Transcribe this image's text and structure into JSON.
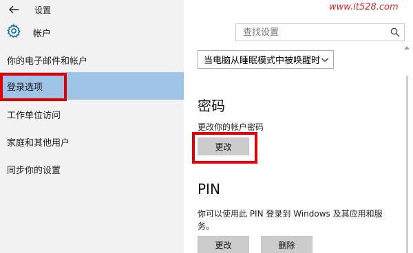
{
  "window": {
    "title": "设置"
  },
  "header": {
    "title": "帐户"
  },
  "search": {
    "placeholder": "查找设置"
  },
  "sidebar": {
    "items": [
      {
        "label": "你的电子邮件和帐户",
        "selected": false
      },
      {
        "label": "登录选项",
        "selected": true
      },
      {
        "label": "工作单位访问",
        "selected": false
      },
      {
        "label": "家庭和其他用户",
        "selected": false
      },
      {
        "label": "同步你的设置",
        "selected": false
      }
    ]
  },
  "main": {
    "wake_dropdown": {
      "value": "当电脑从睡眠模式中被唤醒时"
    },
    "password": {
      "title": "密码",
      "description": "更改你的帐户密码",
      "change_label": "更改"
    },
    "pin": {
      "title": "PIN",
      "description": "你可以使用此 PIN 登录到 Windows 及其应用和服务。",
      "change_label": "更改",
      "remove_label": "删除"
    }
  },
  "watermark": {
    "text": "www.it528.com"
  },
  "colors": {
    "selected_bg": "#9ec3e6",
    "highlight": "#e00000",
    "button_bg": "#cccccc",
    "sidebar_bg": "#f2f2f2"
  },
  "icons": {
    "back": "arrow-left-icon",
    "settings": "gear-icon",
    "search": "search-icon",
    "dropdown": "chevron-down-icon"
  }
}
